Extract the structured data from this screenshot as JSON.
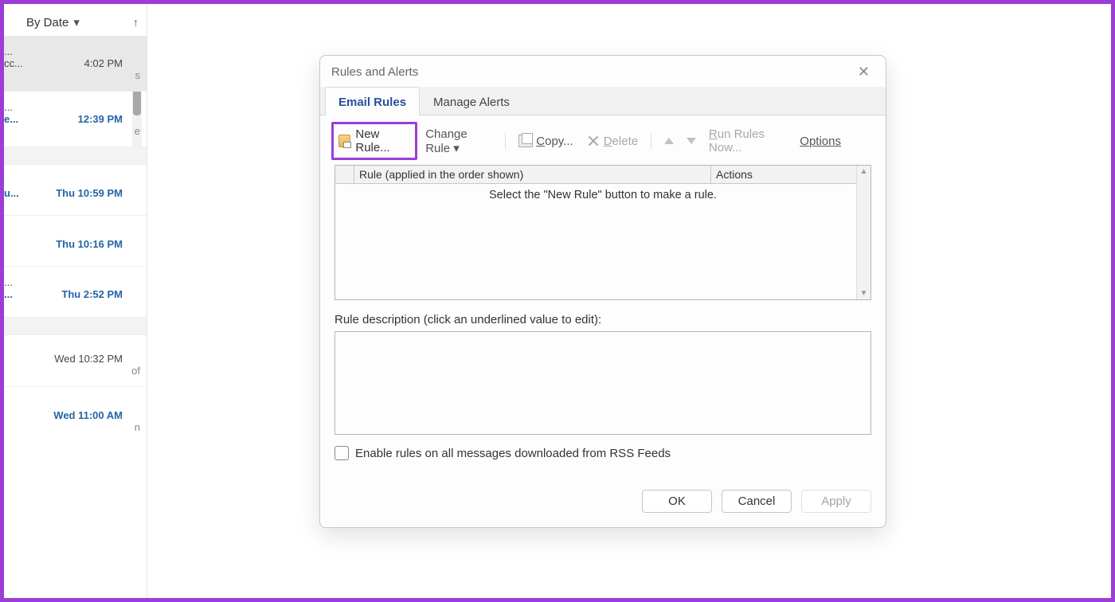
{
  "mail_panel": {
    "sort_label": "By Date",
    "items": [
      {
        "trunc": "...",
        "sub": "cc...",
        "tail": "s",
        "time": "4:02 PM",
        "selected": true
      },
      {
        "trunc": "...",
        "sub": "e...",
        "tail": "e",
        "time": "12:39 PM"
      },
      {
        "group": true
      },
      {
        "trunc": "",
        "sub": "u...",
        "time": "Thu 10:59 PM"
      },
      {
        "trunc": "",
        "sub": "",
        "time": "Thu 10:16 PM"
      },
      {
        "trunc": "...",
        "sub": "...",
        "time": "Thu 2:52 PM"
      },
      {
        "group": true
      },
      {
        "trunc": "",
        "sub": "of",
        "time": "Wed 10:32 PM"
      },
      {
        "trunc": "",
        "sub": "n",
        "time": "Wed 11:00 AM"
      }
    ]
  },
  "dialog": {
    "title": "Rules and Alerts",
    "tabs": {
      "email_rules": "Email Rules",
      "manage_alerts": "Manage Alerts"
    },
    "toolbar": {
      "new_rule": "New Rule...",
      "change_rule": "Change Rule",
      "copy": "Copy...",
      "delete": "Delete",
      "run_rules_now": "Run Rules Now...",
      "options": "Options"
    },
    "list": {
      "rule_col": "Rule (applied in the order shown)",
      "actions_col": "Actions",
      "empty_message": "Select the \"New Rule\" button to make a rule."
    },
    "desc_label": "Rule description (click an underlined value to edit):",
    "rss_label": "Enable rules on all messages downloaded from RSS Feeds",
    "buttons": {
      "ok": "OK",
      "cancel": "Cancel",
      "apply": "Apply"
    }
  }
}
